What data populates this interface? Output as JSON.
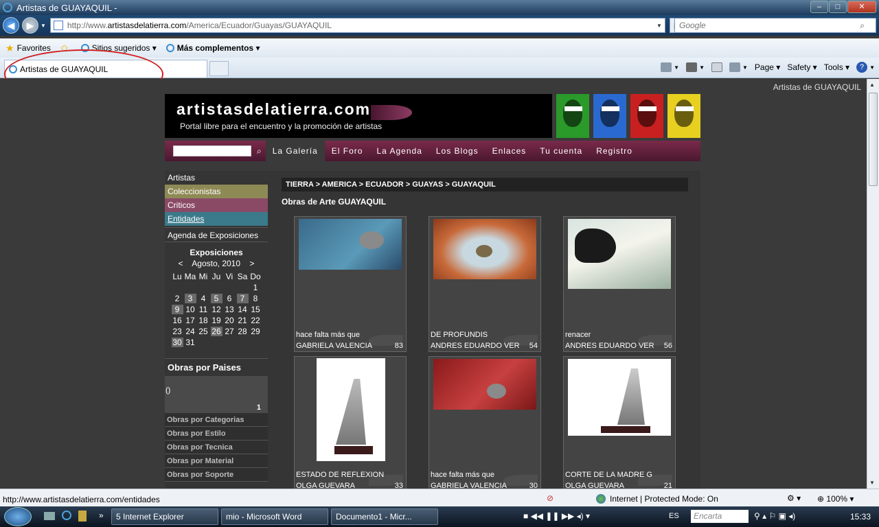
{
  "window": {
    "title": "Artistas de GUAYAQUIL -"
  },
  "address": {
    "url_prefix": "http://www.",
    "url_domain": "artistasdelatierra.com",
    "url_path": "/America/Ecuador/Guayas/GUAYAQUIL"
  },
  "search": {
    "placeholder": "Google"
  },
  "favorites_bar": {
    "favorites": "Favorites",
    "suggested": "Sitios sugeridos",
    "addons": "Más complementos"
  },
  "tab": {
    "title": "Artistas de GUAYAQUIL"
  },
  "commandbar": {
    "page": "Page",
    "safety": "Safety",
    "tools": "Tools",
    "help_glyph": "?"
  },
  "site": {
    "top_ref": "Artistas de GUAYAQUIL",
    "logo": "artistasdelatierra.com",
    "tagline": "Portal libre para el encuentro y la promoción de artistas",
    "face_colors": [
      "#2a9a2a",
      "#2a6ad0",
      "#c82020",
      "#e8d020"
    ],
    "menu": [
      "La Galería",
      "El Foro",
      "La Agenda",
      "Los Blogs",
      "Enlaces",
      "Tu cuenta",
      "Registro"
    ],
    "leftnav": {
      "artistas": "Artistas",
      "coleccionistas": "Coleccionistas",
      "criticos": "Criticos",
      "entidades": "Entidades",
      "agenda": "Agenda de Exposiciones"
    },
    "calendar": {
      "title": "Exposiciones",
      "prev": "<",
      "month": "Agosto, 2010",
      "next": ">",
      "days": [
        "Lu",
        "Ma",
        "Mi",
        "Ju",
        "Vi",
        "Sa",
        "Do"
      ],
      "weeks": [
        [
          "",
          "",
          "",
          "",
          "",
          "",
          "1"
        ],
        [
          "2",
          "3",
          "4",
          "5",
          "6",
          "7",
          "8"
        ],
        [
          "9",
          "10",
          "11",
          "12",
          "13",
          "14",
          "15"
        ],
        [
          "16",
          "17",
          "18",
          "19",
          "20",
          "21",
          "22"
        ],
        [
          "23",
          "24",
          "25",
          "26",
          "27",
          "28",
          "29"
        ],
        [
          "30",
          "31",
          "",
          "",
          "",
          "",
          ""
        ]
      ],
      "highlighted": [
        "3",
        "5",
        "7",
        "9",
        "26",
        "30"
      ]
    },
    "obras_paises": {
      "heading": "Obras por Paises",
      "item": "()",
      "count": "1"
    },
    "category_links": [
      "Obras por Categorias",
      "Obras por Estilo",
      "Obras por Tecnica",
      "Obras por Material",
      "Obras por Soporte"
    ],
    "breadcrumb": "TIERRA > AMERICA > ECUADOR > GUAYAS > GUAYAQUIL",
    "gallery_title": "Obras de Arte GUAYAQUIL",
    "artworks": [
      {
        "title": "hace falta más que",
        "artist": "GABRIELA VALENCIA",
        "count": "83"
      },
      {
        "title": "DE PROFUNDIS",
        "artist": "ANDRES EDUARDO VER",
        "count": "54"
      },
      {
        "title": "renacer",
        "artist": "ANDRES EDUARDO VER",
        "count": "56"
      },
      {
        "title": "ESTADO DE REFLEXION",
        "artist": "OLGA GUEVARA",
        "count": "33"
      },
      {
        "title": "hace falta más que",
        "artist": "GABRIELA VALENCIA",
        "count": "30"
      },
      {
        "title": "CORTE DE LA MADRE G",
        "artist": "OLGA GUEVARA",
        "count": "21"
      }
    ]
  },
  "status": {
    "url": "http://www.artistasdelatierra.com/entidades",
    "zone": "Internet | Protected Mode: On",
    "zoom": "100%"
  },
  "taskbar": {
    "buttons": [
      "5 Internet Explorer",
      "mio - Microsoft Word",
      "Documento1 - Micr..."
    ],
    "lang": "ES",
    "search_placeholder": "Encarta",
    "clock": "15:33"
  }
}
